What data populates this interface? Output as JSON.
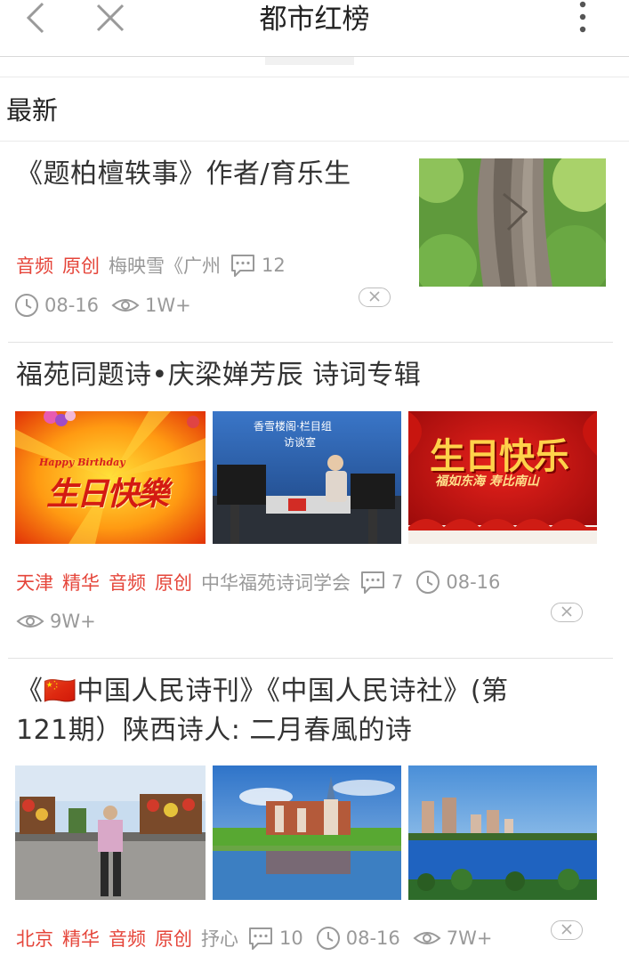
{
  "header": {
    "title": "都市红榜",
    "back_icon": "chevron-left-icon",
    "close_icon": "close-icon",
    "more_icon": "more-vertical-icon"
  },
  "section": {
    "title": "最新"
  },
  "colors": {
    "tag": "#e5453a",
    "meta": "#999999",
    "text": "#333333"
  },
  "articles": [
    {
      "title": "《题柏檀轶事》作者/育乐生",
      "tags": [
        "音频",
        "原创"
      ],
      "source": "梅映雪《广州",
      "comments": "12",
      "date": "08-16",
      "views": "1W+"
    },
    {
      "title": "福苑同题诗•庆梁婵芳辰 诗词专辑",
      "tags": [
        "天津",
        "精华",
        "音频",
        "原创"
      ],
      "source": "中华福苑诗词学会",
      "comments": "7",
      "date": "08-16",
      "views": "9W+",
      "images": [
        {
          "caption_top": "Happy Birthday",
          "caption": "生日快樂"
        },
        {
          "caption_top": "香雪楼阁·栏目组",
          "caption": "访谈室"
        },
        {
          "caption": "生日快乐",
          "caption_sub": "福如东海 寿比南山"
        }
      ]
    },
    {
      "title_line1": "《🇨🇳中国人民诗刊》《中国人民诗社》(第",
      "title_line2": "121期）陕西诗人: 二月春風的诗",
      "tags": [
        "北京",
        "精华",
        "音频",
        "原创"
      ],
      "source": "抒心",
      "comments": "10",
      "date": "08-16",
      "views": "7W+"
    }
  ]
}
